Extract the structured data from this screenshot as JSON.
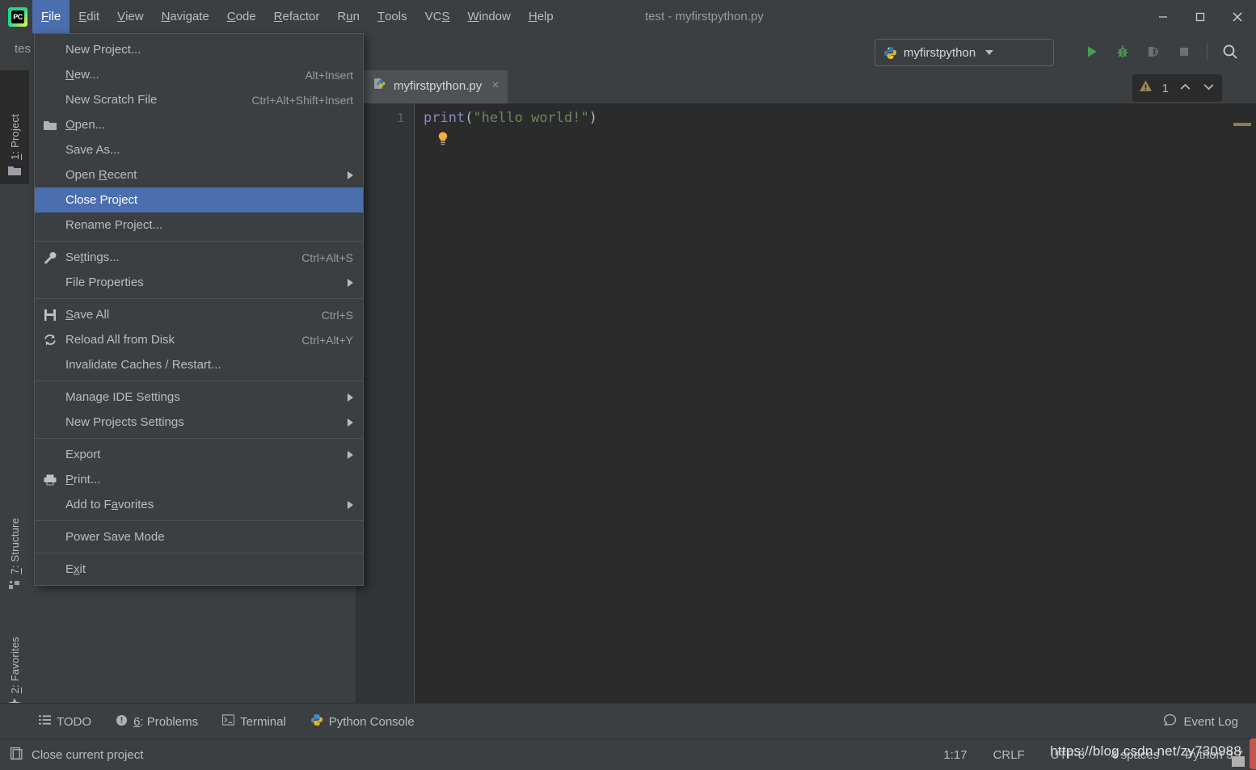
{
  "window": {
    "title": "test - myfirstpython.py",
    "logo_text": "PC",
    "minimize": "minimize-icon",
    "maximize": "maximize-icon",
    "close": "close-icon"
  },
  "menubar": [
    {
      "label": "File",
      "mnemonic": "F",
      "active": true
    },
    {
      "label": "Edit",
      "mnemonic": "E",
      "active": false
    },
    {
      "label": "View",
      "mnemonic": "V",
      "active": false
    },
    {
      "label": "Navigate",
      "mnemonic": "N",
      "active": false
    },
    {
      "label": "Code",
      "mnemonic": "C",
      "active": false
    },
    {
      "label": "Refactor",
      "mnemonic": "R",
      "active": false
    },
    {
      "label": "Run",
      "mnemonic": "u",
      "active": false
    },
    {
      "label": "Tools",
      "mnemonic": "T",
      "active": false
    },
    {
      "label": "VCS",
      "mnemonic": "S",
      "active": false
    },
    {
      "label": "Window",
      "mnemonic": "W",
      "active": false
    },
    {
      "label": "Help",
      "mnemonic": "H",
      "active": false
    }
  ],
  "file_menu": {
    "items": [
      {
        "label": "New Project...",
        "accel": "",
        "icon": "",
        "arrow": false,
        "selected": false,
        "sep_after": false
      },
      {
        "label": "New...",
        "accel": "Alt+Insert",
        "icon": "",
        "arrow": false,
        "selected": false,
        "sep_after": false
      },
      {
        "label": "New Scratch File",
        "accel": "Ctrl+Alt+Shift+Insert",
        "icon": "",
        "arrow": false,
        "selected": false,
        "sep_after": false
      },
      {
        "label": "Open...",
        "accel": "",
        "icon": "folder-icon",
        "arrow": false,
        "selected": false,
        "sep_after": false
      },
      {
        "label": "Save As...",
        "accel": "",
        "icon": "",
        "arrow": false,
        "selected": false,
        "sep_after": false
      },
      {
        "label": "Open Recent",
        "accel": "",
        "icon": "",
        "arrow": true,
        "selected": false,
        "sep_after": false
      },
      {
        "label": "Close Project",
        "accel": "",
        "icon": "",
        "arrow": false,
        "selected": true,
        "sep_after": false
      },
      {
        "label": "Rename Project...",
        "accel": "",
        "icon": "",
        "arrow": false,
        "selected": false,
        "sep_after": true
      },
      {
        "label": "Settings...",
        "accel": "Ctrl+Alt+S",
        "icon": "wrench-icon",
        "arrow": false,
        "selected": false,
        "sep_after": false
      },
      {
        "label": "File Properties",
        "accel": "",
        "icon": "",
        "arrow": true,
        "selected": false,
        "sep_after": true
      },
      {
        "label": "Save All",
        "accel": "Ctrl+S",
        "icon": "save-icon",
        "arrow": false,
        "selected": false,
        "sep_after": false
      },
      {
        "label": "Reload All from Disk",
        "accel": "Ctrl+Alt+Y",
        "icon": "reload-icon",
        "arrow": false,
        "selected": false,
        "sep_after": false
      },
      {
        "label": "Invalidate Caches / Restart...",
        "accel": "",
        "icon": "",
        "arrow": false,
        "selected": false,
        "sep_after": true
      },
      {
        "label": "Manage IDE Settings",
        "accel": "",
        "icon": "",
        "arrow": true,
        "selected": false,
        "sep_after": false
      },
      {
        "label": "New Projects Settings",
        "accel": "",
        "icon": "",
        "arrow": true,
        "selected": false,
        "sep_after": true
      },
      {
        "label": "Export",
        "accel": "",
        "icon": "",
        "arrow": true,
        "selected": false,
        "sep_after": false
      },
      {
        "label": "Print...",
        "accel": "",
        "icon": "printer-icon",
        "arrow": false,
        "selected": false,
        "sep_after": false
      },
      {
        "label": "Add to Favorites",
        "accel": "",
        "icon": "",
        "arrow": true,
        "selected": false,
        "sep_after": true
      },
      {
        "label": "Power Save Mode",
        "accel": "",
        "icon": "",
        "arrow": false,
        "selected": false,
        "sep_after": true
      },
      {
        "label": "Exit",
        "accel": "",
        "icon": "",
        "arrow": false,
        "selected": false,
        "sep_after": false
      }
    ]
  },
  "toolbar": {
    "project_label": "tes",
    "run_config": "myfirstpython",
    "run_button": "run-icon",
    "debug_button": "debug-icon",
    "coverage_button": "coverage-icon",
    "stop_button": "stop-icon",
    "search_button": "search-icon"
  },
  "left_strip": [
    {
      "label": "1: Project",
      "mnemonic": "1",
      "icon": "folder-icon",
      "selected": true
    },
    {
      "label": "7: Structure",
      "mnemonic": "7",
      "icon": "structure-icon",
      "selected": false
    },
    {
      "label": "2: Favorites",
      "mnemonic": "2",
      "icon": "star-icon",
      "selected": false
    }
  ],
  "editor": {
    "tab": {
      "label": "myfirstpython.py",
      "icon": "python-file-icon",
      "close": "×"
    },
    "line_number": "1",
    "code": {
      "func": "print",
      "open_paren": "(",
      "string": "\"hello world!\"",
      "close_paren": ")"
    },
    "hint_icon": "lightbulb-icon",
    "inspection": {
      "icon": "warning-icon",
      "count": "1",
      "prev": "prev-occurrence-icon",
      "next": "next-occurrence-icon"
    }
  },
  "bottom_bar": {
    "items": [
      {
        "label": "TODO",
        "icon": "todo-icon",
        "mnemonic": ""
      },
      {
        "label": "6: Problems",
        "icon": "problems-icon",
        "mnemonic": "6"
      },
      {
        "label": "Terminal",
        "icon": "terminal-icon",
        "mnemonic": ""
      },
      {
        "label": "Python Console",
        "icon": "python-icon",
        "mnemonic": ""
      }
    ],
    "event_log": {
      "label": "Event Log",
      "icon": "event-log-icon"
    }
  },
  "status_bar": {
    "message": "Close current project",
    "message_icon": "project-icon",
    "caret_position": "1:17",
    "line_separator": "CRLF",
    "encoding": "UTF-8",
    "indent": "4 spaces",
    "interpreter": "Python 3.7",
    "lock_icon": "lock-icon"
  },
  "watermark": "https://blog.csdn.net/zy730988",
  "colors": {
    "chrome": "#3c3f41",
    "editor_bg": "#2b2b2b",
    "highlight": "#4b6eaf",
    "accent_green": "#499c54",
    "warning": "#8a7e4e",
    "error_red": "#c75450",
    "string_green": "#6a8759",
    "keyword_purple": "#8888c6"
  }
}
